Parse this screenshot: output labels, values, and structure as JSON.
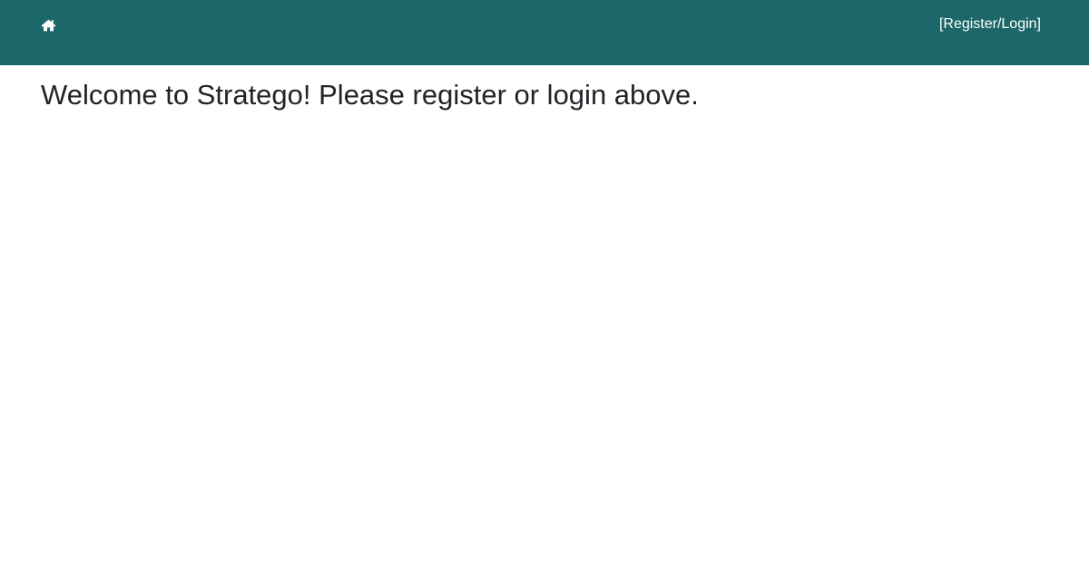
{
  "navbar": {
    "home_icon": "home-icon",
    "auth_link_label": "[Register/Login]",
    "background_color": "#1c6769",
    "text_color": "#ffffff"
  },
  "main": {
    "welcome_message": "Welcome to Stratego! Please register or login above."
  }
}
